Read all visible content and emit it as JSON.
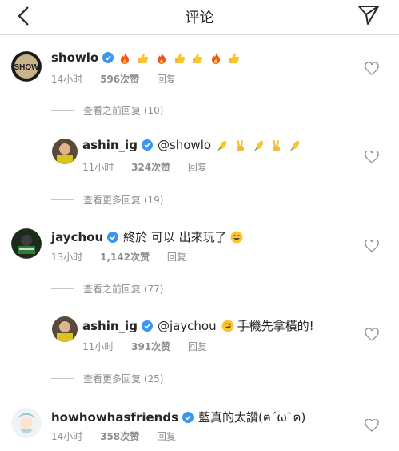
{
  "header": {
    "title": "评论"
  },
  "comments": [
    {
      "username": "showlo",
      "text": "",
      "time": "14小时",
      "likes": "596次赞",
      "reply": "回复"
    },
    {
      "username": "ashin_ig",
      "mention": "@showlo",
      "text": "",
      "time": "11小时",
      "likes": "324次赞",
      "reply": "回复"
    },
    {
      "username": "jaychou",
      "text": "終於 可以 出來玩了",
      "time": "13小时",
      "likes": "1,142次赞",
      "reply": "回复"
    },
    {
      "username": "ashin_ig",
      "mention": "@jaychou",
      "text": "手機先拿橫的!",
      "time": "11小时",
      "likes": "391次赞",
      "reply": "回复"
    },
    {
      "username": "howhowhasfriends",
      "text": "藍真的太讚(ฅ´ω`ฅ)",
      "time": "14小时",
      "likes": "358次赞",
      "reply": "回复"
    }
  ],
  "threads": [
    {
      "label": "查看之前回复 (10)"
    },
    {
      "label": "查看更多回复 (19)"
    },
    {
      "label": "查看之前回复 (77)"
    },
    {
      "label": "查看更多回复 (25)"
    }
  ],
  "avatars": {
    "showlo": "SHOW"
  },
  "colors": {
    "verified": "#3897f0",
    "meta": "#8e8e8e",
    "divider": "#dbdbdb"
  }
}
